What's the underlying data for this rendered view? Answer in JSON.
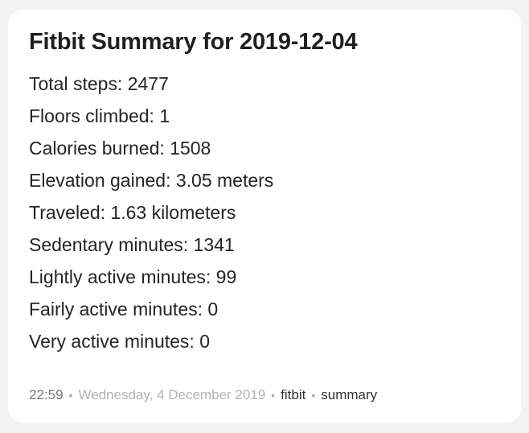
{
  "card": {
    "title": "Fitbit Summary for 2019-12-04",
    "stats": [
      "Total steps: 2477",
      "Floors climbed: 1",
      "Calories burned: 1508",
      "Elevation gained: 3.05 meters",
      "Traveled: 1.63 kilometers",
      "Sedentary minutes: 1341",
      "Lightly active minutes: 99",
      "Fairly active minutes: 0",
      "Very active minutes: 0"
    ],
    "meta": {
      "time": "22:59",
      "separator": "•",
      "date": "Wednesday, 4 December 2019",
      "tags": [
        "fitbit",
        "summary"
      ]
    }
  }
}
